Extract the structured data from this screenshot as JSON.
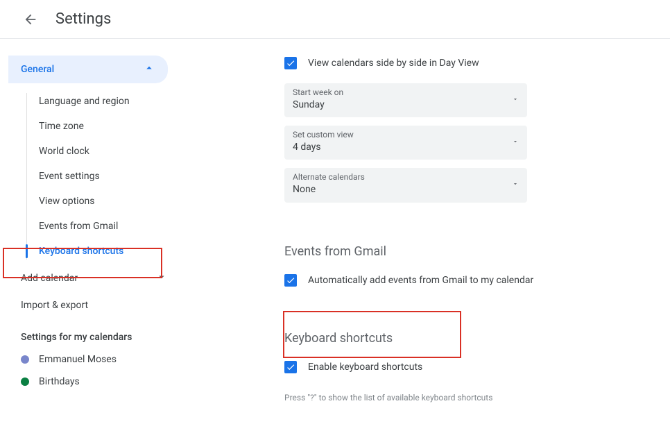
{
  "header": {
    "title": "Settings"
  },
  "sidebar": {
    "general": {
      "label": "General",
      "items": [
        {
          "label": "Language and region",
          "active": false
        },
        {
          "label": "Time zone",
          "active": false
        },
        {
          "label": "World clock",
          "active": false
        },
        {
          "label": "Event settings",
          "active": false
        },
        {
          "label": "View options",
          "active": false
        },
        {
          "label": "Events from Gmail",
          "active": false
        },
        {
          "label": "Keyboard shortcuts",
          "active": true
        }
      ]
    },
    "add_calendar": {
      "label": "Add calendar"
    },
    "import_export": {
      "label": "Import & export"
    },
    "my_calendars": {
      "heading": "Settings for my calendars",
      "items": [
        {
          "label": "Emmanuel Moses",
          "color": "#7986cb"
        },
        {
          "label": "Birthdays",
          "color": "#0b8043"
        }
      ]
    }
  },
  "main": {
    "view_side_by_side": "View calendars side by side in Day View",
    "start_week": {
      "label": "Start week on",
      "value": "Sunday"
    },
    "custom_view": {
      "label": "Set custom view",
      "value": "4 days"
    },
    "alt_cal": {
      "label": "Alternate calendars",
      "value": "None"
    },
    "events_gmail": {
      "title": "Events from Gmail",
      "checkbox": "Automatically add events from Gmail to my calendar"
    },
    "keyboard_shortcuts": {
      "title": "Keyboard shortcuts",
      "checkbox": "Enable keyboard shortcuts",
      "help": "Press \"?\" to show the list of available keyboard shortcuts"
    }
  }
}
